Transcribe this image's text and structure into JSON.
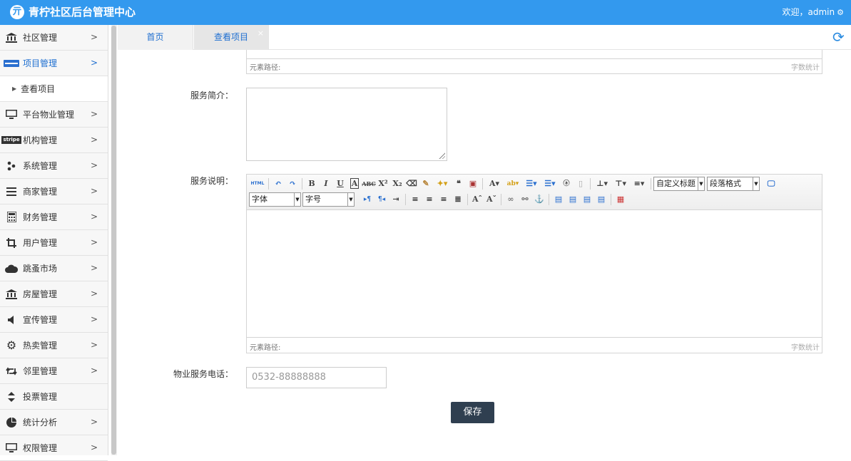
{
  "header": {
    "title": "青柠社区后台管理中心",
    "welcome": "欢迎，admin",
    "logo_char": "亓"
  },
  "sidebar": {
    "items": [
      {
        "label": "社区管理",
        "icon": "bank-icon"
      },
      {
        "label": "项目管理",
        "icon": "card-icon",
        "active": true
      },
      {
        "label": "平台物业管理",
        "icon": "monitor-icon"
      },
      {
        "label": "机构管理",
        "icon": "stripe-icon"
      },
      {
        "label": "系统管理",
        "icon": "network-icon"
      },
      {
        "label": "商家管理",
        "icon": "list-icon"
      },
      {
        "label": "财务管理",
        "icon": "calculator-icon"
      },
      {
        "label": "用户管理",
        "icon": "crop-icon"
      },
      {
        "label": "跳蚤市场",
        "icon": "cloud-icon"
      },
      {
        "label": "房屋管理",
        "icon": "bank-icon"
      },
      {
        "label": "宣传管理",
        "icon": "volume-icon"
      },
      {
        "label": "热卖管理",
        "icon": "gear-icon"
      },
      {
        "label": "邻里管理",
        "icon": "retweet-icon"
      },
      {
        "label": "投票管理",
        "icon": "sort-icon"
      },
      {
        "label": "统计分析",
        "icon": "pie-chart-icon"
      },
      {
        "label": "权限管理",
        "icon": "monitor-icon"
      }
    ],
    "subitem": "查看项目"
  },
  "tabs": [
    {
      "label": "首页"
    },
    {
      "label": "查看项目"
    }
  ],
  "editor_top": {
    "path_label": "元素路径:",
    "count_label": "字数统计"
  },
  "form": {
    "intro_label": "服务简介：",
    "desc_label": "服务说明：",
    "phone_label": "物业服务电话：",
    "phone_value": "0532-88888888",
    "save_label": "保存"
  },
  "editor": {
    "title_select": "自定义标题",
    "para_select": "段落格式",
    "font_select": "字体",
    "size_select": "字号",
    "html_btn": "HTML",
    "path_label": "元素路径:",
    "count_label": "字数统计"
  },
  "colors": {
    "header": "#3399ee",
    "save_button": "#2f3f50",
    "active_nav": "#1f6fd0"
  }
}
